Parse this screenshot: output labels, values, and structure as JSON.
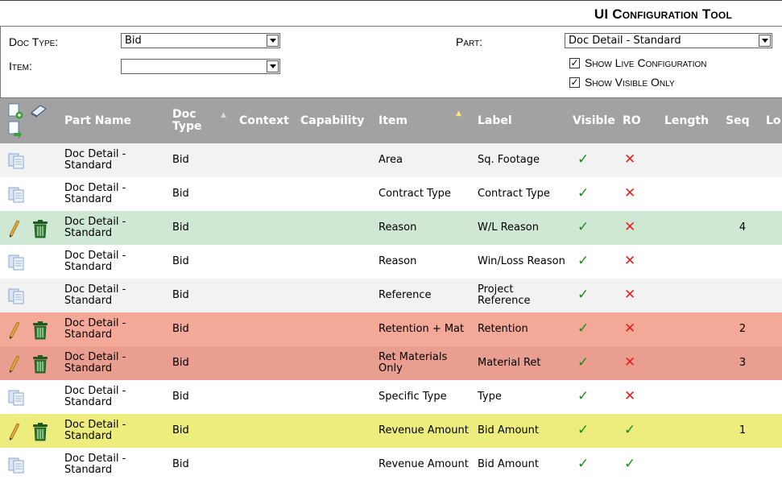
{
  "title": "UI Configuration Tool",
  "filters": {
    "doc_type_label": "Doc Type:",
    "doc_type_value": "Bid",
    "item_label": "Item:",
    "item_value": "",
    "part_label": "Part:",
    "part_value": "Doc Detail - Standard",
    "show_live_label": "Show Live Configuration",
    "show_visible_label": "Show Visible Only",
    "show_live_checked": true,
    "show_visible_checked": true
  },
  "columns": {
    "part_name": "Part Name",
    "doc_type": "Doc Type",
    "context": "Context",
    "capability": "Capability",
    "item": "Item",
    "label": "Label",
    "visible": "Visible",
    "ro": "RO",
    "length": "Length",
    "seq": "Seq",
    "lo": "Lo"
  },
  "rows": [
    {
      "part": "Doc Detail - Standard",
      "doc_type": "Bid",
      "context": "",
      "capability": "",
      "item": "Area",
      "label": "Sq. Footage",
      "visible": true,
      "ro": false,
      "length": "",
      "seq": "",
      "configured": false
    },
    {
      "part": "Doc Detail - Standard",
      "doc_type": "Bid",
      "context": "",
      "capability": "",
      "item": "Contract Type",
      "label": "Contract Type",
      "visible": true,
      "ro": false,
      "length": "",
      "seq": "",
      "configured": false
    },
    {
      "part": "Doc Detail - Standard",
      "doc_type": "Bid",
      "context": "",
      "capability": "",
      "item": "Reason",
      "label": "W/L Reason",
      "visible": true,
      "ro": false,
      "length": "",
      "seq": "4",
      "configured": true
    },
    {
      "part": "Doc Detail - Standard",
      "doc_type": "Bid",
      "context": "",
      "capability": "",
      "item": "Reason",
      "label": "Win/Loss Reason",
      "visible": true,
      "ro": false,
      "length": "",
      "seq": "",
      "configured": false
    },
    {
      "part": "Doc Detail - Standard",
      "doc_type": "Bid",
      "context": "",
      "capability": "",
      "item": "Reference",
      "label": "Project Reference",
      "visible": true,
      "ro": false,
      "length": "",
      "seq": "",
      "configured": false
    },
    {
      "part": "Doc Detail - Standard",
      "doc_type": "Bid",
      "context": "",
      "capability": "",
      "item": "Retention + Mat",
      "label": "Retention",
      "visible": true,
      "ro": false,
      "length": "",
      "seq": "2",
      "configured": true
    },
    {
      "part": "Doc Detail - Standard",
      "doc_type": "Bid",
      "context": "",
      "capability": "",
      "item": "Ret Materials Only",
      "label": "Material Ret",
      "visible": true,
      "ro": false,
      "length": "",
      "seq": "3",
      "configured": true
    },
    {
      "part": "Doc Detail - Standard",
      "doc_type": "Bid",
      "context": "",
      "capability": "",
      "item": "Specific Type",
      "label": "Type",
      "visible": true,
      "ro": false,
      "length": "",
      "seq": "",
      "configured": false
    },
    {
      "part": "Doc Detail - Standard",
      "doc_type": "Bid",
      "context": "",
      "capability": "",
      "item": "Revenue Amount",
      "label": "Bid Amount",
      "visible": true,
      "ro": true,
      "length": "",
      "seq": "1",
      "configured": true
    },
    {
      "part": "Doc Detail - Standard",
      "doc_type": "Bid",
      "context": "",
      "capability": "",
      "item": "Revenue Amount",
      "label": "Bid Amount",
      "visible": true,
      "ro": true,
      "length": "",
      "seq": "",
      "configured": false
    }
  ],
  "symbols": {
    "check": "✓",
    "cross": "✕"
  },
  "colors": {
    "header_bg": "#a2a2a2",
    "row_green": "#cfe8d4",
    "row_salmon": "#f4a898",
    "row_red": "#ea9e90",
    "row_yellow": "#eded7d",
    "check": "#1f8a1f",
    "cross": "#e8201a"
  }
}
